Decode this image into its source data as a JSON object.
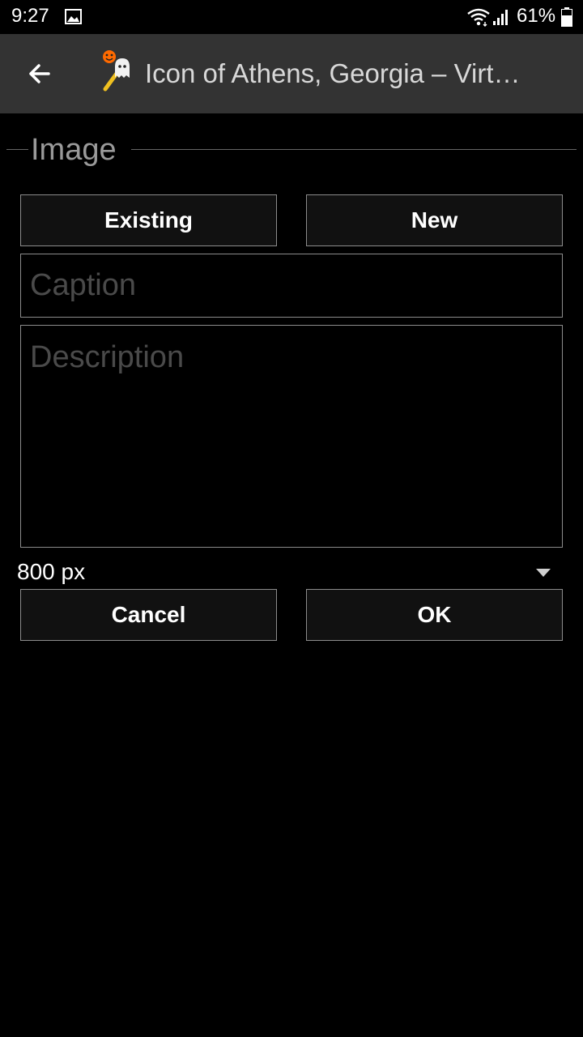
{
  "status_bar": {
    "time": "9:27",
    "battery": "61%",
    "icons": [
      "gallery-icon",
      "wifi-icon",
      "signal-icon",
      "battery-icon"
    ]
  },
  "app_bar": {
    "title": "Icon of Athens, Georgia – Virt…",
    "background": "#333333"
  },
  "section": {
    "title": "Image"
  },
  "buttons": {
    "existing": "Existing",
    "new": "New",
    "cancel": "Cancel",
    "ok": "OK"
  },
  "form": {
    "caption": {
      "value": "",
      "placeholder": "Caption"
    },
    "description": {
      "value": "",
      "placeholder": "Description"
    },
    "size": {
      "selected": "800 px"
    }
  },
  "colors": {
    "background": "#000000",
    "button": "#111111",
    "border": "#8c8c8c",
    "placeholder": "#4a4a4a"
  }
}
